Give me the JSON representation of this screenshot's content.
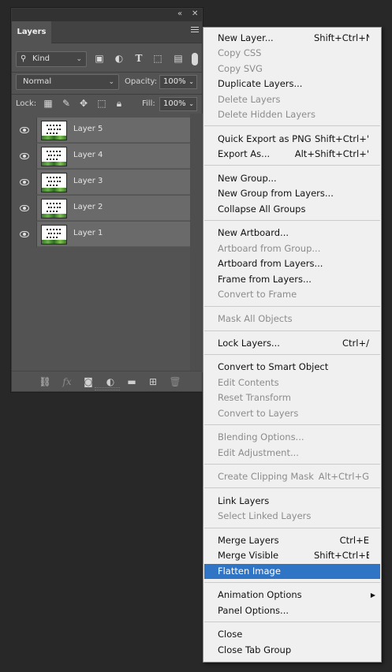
{
  "panel": {
    "collapse_icon": "double-chevron-icon",
    "close_icon": "close-icon",
    "tab_label": "Layers",
    "filter": {
      "kind_label": "Kind",
      "icons": [
        "image-filter-icon",
        "adjustment-filter-icon",
        "type-filter-icon",
        "shape-filter-icon",
        "smart-object-filter-icon"
      ]
    },
    "blend_mode": "Normal",
    "opacity_label": "Opacity:",
    "opacity_value": "100%",
    "lock_label": "Lock:",
    "fill_label": "Fill:",
    "fill_value": "100%",
    "layers": [
      {
        "name": "Layer 5"
      },
      {
        "name": "Layer 4"
      },
      {
        "name": "Layer 3"
      },
      {
        "name": "Layer 2"
      },
      {
        "name": "Layer 1"
      }
    ],
    "bottom_icons": [
      "link-layers-icon",
      "fx-icon",
      "add-mask-icon",
      "adjustment-layer-icon",
      "new-group-icon",
      "new-layer-icon",
      "delete-layer-icon"
    ]
  },
  "menu": {
    "items": [
      {
        "label": "New Layer...",
        "shortcut": "Shift+Ctrl+N",
        "enabled": true
      },
      {
        "label": "Copy CSS",
        "shortcut": "",
        "enabled": false
      },
      {
        "label": "Copy SVG",
        "shortcut": "",
        "enabled": false
      },
      {
        "label": "Duplicate Layers...",
        "shortcut": "",
        "enabled": true
      },
      {
        "label": "Delete Layers",
        "shortcut": "",
        "enabled": false
      },
      {
        "label": "Delete Hidden Layers",
        "shortcut": "",
        "enabled": false
      },
      {
        "label": "Quick Export as PNG",
        "shortcut": "Shift+Ctrl+'",
        "enabled": true
      },
      {
        "label": "Export As...",
        "shortcut": "Alt+Shift+Ctrl+'",
        "enabled": true
      },
      {
        "label": "New Group...",
        "shortcut": "",
        "enabled": true
      },
      {
        "label": "New Group from Layers...",
        "shortcut": "",
        "enabled": true
      },
      {
        "label": "Collapse All Groups",
        "shortcut": "",
        "enabled": true
      },
      {
        "label": "New Artboard...",
        "shortcut": "",
        "enabled": true
      },
      {
        "label": "Artboard from Group...",
        "shortcut": "",
        "enabled": false
      },
      {
        "label": "Artboard from Layers...",
        "shortcut": "",
        "enabled": true
      },
      {
        "label": "Frame from Layers...",
        "shortcut": "",
        "enabled": true
      },
      {
        "label": "Convert to Frame",
        "shortcut": "",
        "enabled": false
      },
      {
        "label": "Mask All Objects",
        "shortcut": "",
        "enabled": false
      },
      {
        "label": "Lock Layers...",
        "shortcut": "Ctrl+/",
        "enabled": true
      },
      {
        "label": "Convert to Smart Object",
        "shortcut": "",
        "enabled": true
      },
      {
        "label": "Edit Contents",
        "shortcut": "",
        "enabled": false
      },
      {
        "label": "Reset Transform",
        "shortcut": "",
        "enabled": false
      },
      {
        "label": "Convert to Layers",
        "shortcut": "",
        "enabled": false
      },
      {
        "label": "Blending Options...",
        "shortcut": "",
        "enabled": false
      },
      {
        "label": "Edit Adjustment...",
        "shortcut": "",
        "enabled": false
      },
      {
        "label": "Create Clipping Mask",
        "shortcut": "Alt+Ctrl+G",
        "enabled": false
      },
      {
        "label": "Link Layers",
        "shortcut": "",
        "enabled": true
      },
      {
        "label": "Select Linked Layers",
        "shortcut": "",
        "enabled": false
      },
      {
        "label": "Merge Layers",
        "shortcut": "Ctrl+E",
        "enabled": true
      },
      {
        "label": "Merge Visible",
        "shortcut": "Shift+Ctrl+E",
        "enabled": true
      },
      {
        "label": "Flatten Image",
        "shortcut": "",
        "enabled": true,
        "highlighted": true
      },
      {
        "label": "Animation Options",
        "shortcut": "",
        "enabled": true,
        "submenu": true
      },
      {
        "label": "Panel Options...",
        "shortcut": "",
        "enabled": true
      },
      {
        "label": "Close",
        "shortcut": "",
        "enabled": true
      },
      {
        "label": "Close Tab Group",
        "shortcut": "",
        "enabled": true
      }
    ]
  },
  "colors": {
    "highlight": "#2f74c5",
    "menu_bg": "#f0f0f0",
    "panel_bg": "#535353",
    "layer_row_bg": "#6a6a6a"
  }
}
